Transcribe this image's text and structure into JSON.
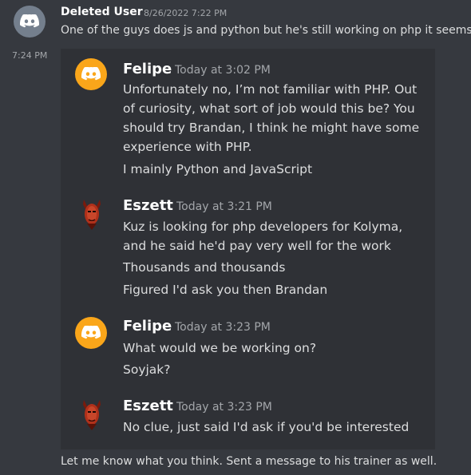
{
  "top_message": {
    "author": "Deleted User",
    "timestamp": "8/26/2022 7:22 PM",
    "text": "One of the guys does js and python but he's still working on php it seems"
  },
  "side_timestamp": "7:24 PM",
  "embedded": [
    {
      "author": "Felipe",
      "timestamp": "Today at 3:02 PM",
      "lines": [
        "Unfortunately no, I’m not familiar with PHP. Out of curiosity, what sort of job would this be? You should try Brandan, I think he might have some experience with PHP.",
        "I mainly Python and JavaScript"
      ]
    },
    {
      "author": "Eszett",
      "timestamp": "Today at 3:21 PM",
      "lines": [
        "Kuz is looking for php developers for Kolyma, and he said he'd pay very well for the work",
        "Thousands and thousands",
        "Figured I'd ask you then Brandan"
      ]
    },
    {
      "author": "Felipe",
      "timestamp": "Today at 3:23 PM",
      "lines": [
        "What would we be working on?",
        "Soyjak?"
      ]
    },
    {
      "author": "Eszett",
      "timestamp": "Today at 3:23 PM",
      "lines": [
        "No clue, just said I'd ask if you'd be interested"
      ]
    }
  ],
  "bottom_message": {
    "text": "Let me know what you think. Sent a message to his trainer as well."
  }
}
